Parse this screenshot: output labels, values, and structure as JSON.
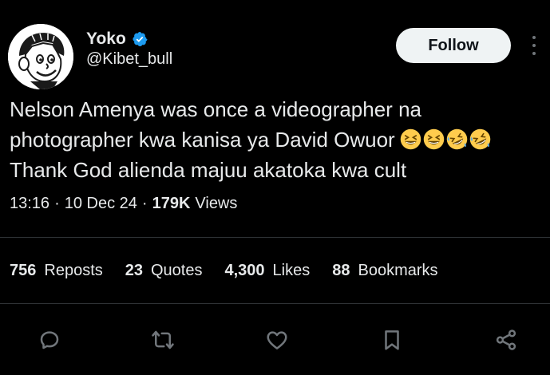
{
  "author": {
    "display_name": "Yoko",
    "handle": "@Kibet_bull",
    "verified": true,
    "avatar_icon": "cartoon-boy-avatar"
  },
  "header": {
    "follow_label": "Follow",
    "more_icon": "more-vertical-icon"
  },
  "tweet": {
    "lines": [
      "Nelson Amenya was once a videographer na",
      "photographer kwa kanisa ya David Owuor",
      "Thank God alienda majuu akatoka kwa cult"
    ],
    "emojis": [
      "grinning-squinting-face",
      "grinning-squinting-face",
      "rolling-on-floor-laughing",
      "rolling-on-floor-laughing"
    ]
  },
  "meta": {
    "time": "13:16",
    "date": "10 Dec 24",
    "views_count": "179K",
    "views_label": "Views"
  },
  "stats": [
    {
      "count": "756",
      "label": "Reposts"
    },
    {
      "count": "23",
      "label": "Quotes"
    },
    {
      "count": "4,300",
      "label": "Likes"
    },
    {
      "count": "88",
      "label": "Bookmarks"
    }
  ],
  "actions": [
    "reply-icon",
    "repost-icon",
    "like-icon",
    "bookmark-icon",
    "share-icon"
  ],
  "colors": {
    "background": "#000000",
    "text": "#e7e9ea",
    "secondary": "#71767b",
    "verified": "#1d9bf0",
    "divider": "#2f3336",
    "follow_bg": "#eff3f4"
  }
}
